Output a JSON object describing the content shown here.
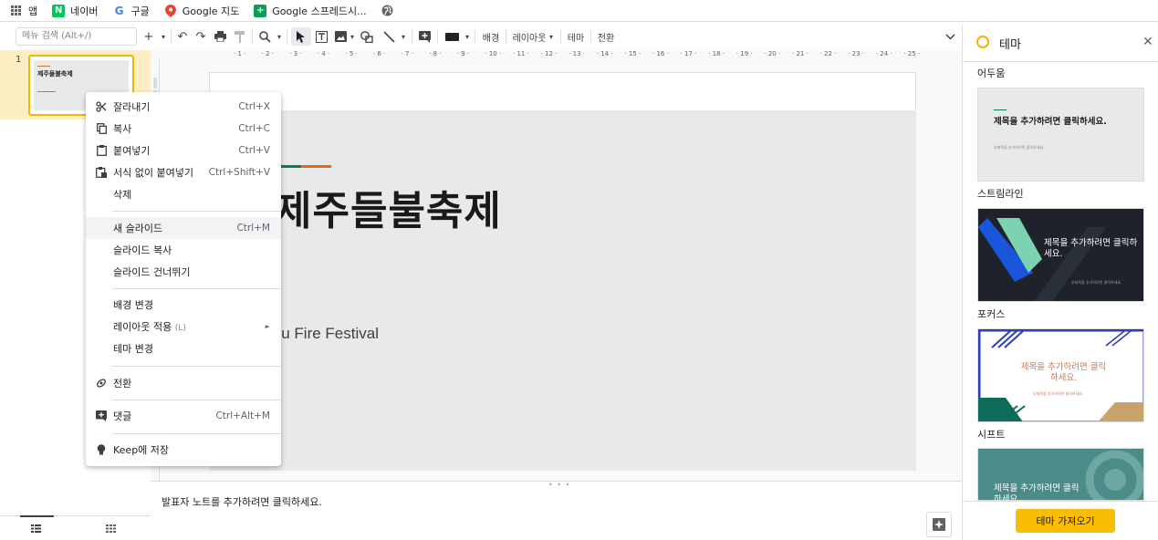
{
  "bookmarks": [
    {
      "label": "앱",
      "icon": "apps-icon"
    },
    {
      "label": "네이버",
      "icon": "naver-icon",
      "color": "#03c75a"
    },
    {
      "label": "구글",
      "icon": "google-icon"
    },
    {
      "label": "Google 지도",
      "icon": "maps-pin-icon"
    },
    {
      "label": "Google 스프레드시...",
      "icon": "sheets-icon",
      "color": "#0f9d58"
    }
  ],
  "toolbar": {
    "search_placeholder": "메뉴 검색 (Alt+/)",
    "background_label": "배경",
    "layout_label": "레이아웃",
    "theme_label": "테마",
    "transition_label": "전환"
  },
  "ruler": {
    "ticks": [
      "1",
      "2",
      "3",
      "4",
      "5",
      "6",
      "7",
      "8",
      "9",
      "10",
      "11",
      "12",
      "13",
      "14",
      "15",
      "16",
      "17",
      "18",
      "19",
      "20",
      "21",
      "22",
      "23",
      "24",
      "25"
    ]
  },
  "filmstrip": {
    "slide_number": "1",
    "thumb_title": "제주들불축제"
  },
  "slide": {
    "title": "제주들불축제",
    "subtitle": "eju Fire Festival"
  },
  "notes": {
    "placeholder": "발표자 노트를 추가하려면 클릭하세요."
  },
  "context_menu": {
    "cut": {
      "label": "잘라내기",
      "shortcut": "Ctrl+X"
    },
    "copy": {
      "label": "복사",
      "shortcut": "Ctrl+C"
    },
    "paste": {
      "label": "붙여넣기",
      "shortcut": "Ctrl+V"
    },
    "paste_plain": {
      "label": "서식 없이 붙여넣기",
      "shortcut": "Ctrl+Shift+V"
    },
    "delete": {
      "label": "삭제"
    },
    "new_slide": {
      "label": "새 슬라이드",
      "shortcut": "Ctrl+M"
    },
    "duplicate_slide": {
      "label": "슬라이드 복사"
    },
    "skip_slide": {
      "label": "슬라이드 건너뛰기"
    },
    "change_background": {
      "label": "배경 변경"
    },
    "apply_layout": {
      "label": "레이아웃 적용",
      "hint": "(L)"
    },
    "change_theme": {
      "label": "테마 변경"
    },
    "transition": {
      "label": "전환"
    },
    "comment": {
      "label": "댓글",
      "shortcut": "Ctrl+Alt+M"
    },
    "keep": {
      "label": "Keep에 저장"
    }
  },
  "theme_panel": {
    "title": "테마",
    "themes": [
      {
        "name": "어두움",
        "title": "제목을 추가하려면 클릭하세요.",
        "subtitle": "부제목을 추가하려면 클릭하세요."
      },
      {
        "name": "스트림라인",
        "title": "제목을 추가하려면 클릭하세요.",
        "subtitle": "부제목을 추가하려면 클릭하세요."
      },
      {
        "name": "포커스",
        "title": "제목을 추가하려면 클릭하세요.",
        "subtitle": "부제목을 추가하려면 클릭하세요."
      },
      {
        "name": "시프트",
        "title": "제목을 추가하려면 클릭하세요."
      }
    ],
    "import_label": "테마 가져오기"
  },
  "colors": {
    "accent": "#fbbc04",
    "selection": "#fdefc3",
    "slide_bg": "#e8eaea"
  }
}
